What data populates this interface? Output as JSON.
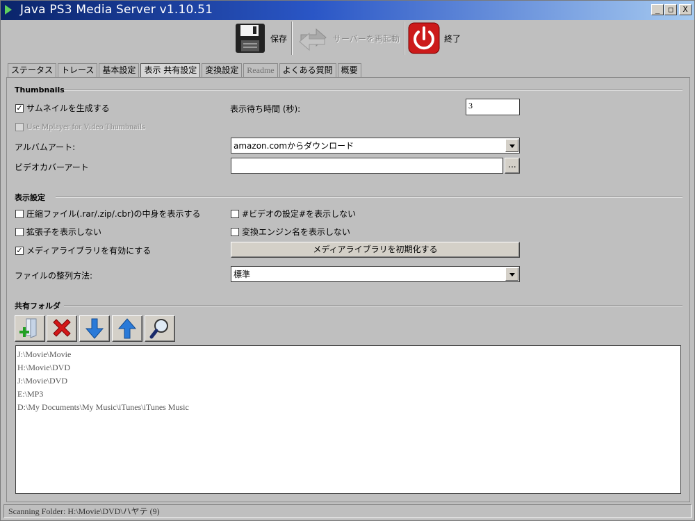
{
  "window": {
    "title": "Java PS3 Media Server v1.10.51",
    "controls": {
      "minimize": "_",
      "maximize": "□",
      "close": "X"
    }
  },
  "toolbar": {
    "save_label": "保存",
    "restart_label": "サーバーを再起動",
    "quit_label": "終了"
  },
  "tabs": [
    {
      "label": "ステータス"
    },
    {
      "label": "トレース"
    },
    {
      "label": "基本設定"
    },
    {
      "label": "表示 共有設定",
      "active": true
    },
    {
      "label": "変換設定"
    },
    {
      "label": "Readme",
      "disabled": true
    },
    {
      "label": "よくある質問"
    },
    {
      "label": "概要"
    }
  ],
  "thumbnails": {
    "section_title": "Thumbnails",
    "generate_label": "サムネイルを生成する",
    "generate_checked": true,
    "wait_label": "表示待ち時間 (秒):",
    "wait_value": "3",
    "mplayer_label": "Use Mplayer for Video Thumbnails",
    "mplayer_checked": false,
    "album_art_label": "アルバムアート:",
    "album_art_value": "amazon.comからダウンロード",
    "video_cover_label": "ビデオカバーアート",
    "video_cover_value": "",
    "browse_label": "..."
  },
  "display": {
    "section_title": "表示設定",
    "compressed_label": "圧縮ファイル(.rar/.zip/.cbr)の中身を表示する",
    "compressed_checked": false,
    "hide_video_settings_label": "#ビデオの設定#を表示しない",
    "hide_video_settings_checked": false,
    "hide_extension_label": "拡張子を表示しない",
    "hide_extension_checked": false,
    "hide_engine_label": "変換エンジン名を表示しない",
    "hide_engine_checked": false,
    "media_library_label": "メディアライブラリを有効にする",
    "media_library_checked": true,
    "reset_library_label": "メディアライブラリを初期化する",
    "sort_label": "ファイルの整列方法:",
    "sort_value": "標準"
  },
  "shared": {
    "section_title": "共有フォルダ",
    "buttons": [
      "add-folder-icon",
      "remove-icon",
      "move-down-icon",
      "move-up-icon",
      "search-icon"
    ],
    "folders": [
      "J:\\Movie\\Movie",
      "H:\\Movie\\DVD",
      "J:\\Movie\\DVD",
      "E:\\MP3",
      "D:\\My Documents\\My Music\\iTunes\\iTunes Music"
    ]
  },
  "status": {
    "text": "Scanning Folder: H:\\Movie\\DVD\\ハヤテ (9)"
  }
}
